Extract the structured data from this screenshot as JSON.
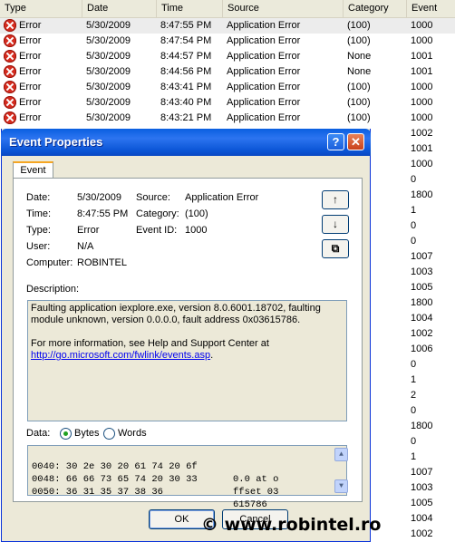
{
  "columns": [
    "Type",
    "Date",
    "Time",
    "Source",
    "Category",
    "Event"
  ],
  "rows": [
    {
      "type": "Error",
      "date": "5/30/2009",
      "time": "8:47:55 PM",
      "source": "Application Error",
      "category": "(100)",
      "event": "1000"
    },
    {
      "type": "Error",
      "date": "5/30/2009",
      "time": "8:47:54 PM",
      "source": "Application Error",
      "category": "(100)",
      "event": "1000"
    },
    {
      "type": "Error",
      "date": "5/30/2009",
      "time": "8:44:57 PM",
      "source": "Application Error",
      "category": "None",
      "event": "1001"
    },
    {
      "type": "Error",
      "date": "5/30/2009",
      "time": "8:44:56 PM",
      "source": "Application Error",
      "category": "None",
      "event": "1001"
    },
    {
      "type": "Error",
      "date": "5/30/2009",
      "time": "8:43:41 PM",
      "source": "Application Error",
      "category": "(100)",
      "event": "1000"
    },
    {
      "type": "Error",
      "date": "5/30/2009",
      "time": "8:43:40 PM",
      "source": "Application Error",
      "category": "(100)",
      "event": "1000"
    },
    {
      "type": "Error",
      "date": "5/30/2009",
      "time": "8:43:21 PM",
      "source": "Application Error",
      "category": "(100)",
      "event": "1000"
    }
  ],
  "hidden_rows_events": [
    "1002",
    "1001",
    "1000",
    "0",
    "1800",
    "1",
    "0",
    "0",
    "1007",
    "1003",
    "1005",
    "1800",
    "1004",
    "1002",
    "1006",
    "0",
    "1",
    "2",
    "0",
    "1800",
    "0",
    "1",
    "1007",
    "1003",
    "1005",
    "1004",
    "1002"
  ],
  "dialog": {
    "title": "Event Properties",
    "help_glyph": "?",
    "close_glyph": "✕",
    "tab": "Event",
    "date_label": "Date:",
    "date_value": "5/30/2009",
    "time_label": "Time:",
    "time_value": "8:47:55 PM",
    "type_label": "Type:",
    "type_value": "Error",
    "user_label": "User:",
    "user_value": "N/A",
    "computer_label": "Computer:",
    "computer_value": "ROBINTEL",
    "source_label": "Source:",
    "source_value": "Application Error",
    "category_label": "Category:",
    "category_value": "(100)",
    "eventid_label": "Event ID:",
    "eventid_value": "1000",
    "nav_up": "↑",
    "nav_down": "↓",
    "nav_copy": "⧉",
    "description_label": "Description:",
    "description_line1": "Faulting application iexplore.exe, version 8.0.6001.18702, faulting module unknown, version 0.0.0.0, fault address 0x03615786.",
    "description_line2": "For more information, see Help and Support Center at",
    "description_link": "http://go.microsoft.com/fwlink/events.asp",
    "description_end": ".",
    "data_label": "Data:",
    "bytes_label": "Bytes",
    "words_label": "Words",
    "data_lines": [
      {
        "hex": "0040: 30 2e 30 20 61 74 20 6f",
        "ascii": "0.0 at o"
      },
      {
        "hex": "0048: 66 66 73 65 74 20 30 33",
        "ascii": "ffset 03"
      },
      {
        "hex": "0050: 36 31 35 37 38 36",
        "ascii": "615786"
      }
    ],
    "ok_label": "OK",
    "cancel_label": "Cancel"
  },
  "watermark": "© www.robintel.ro",
  "colors": {
    "title_bar": "#0a5fe0",
    "error_red": "#d52b1e",
    "dialog_bg": "#ece9d8",
    "link": "#0000ee"
  }
}
